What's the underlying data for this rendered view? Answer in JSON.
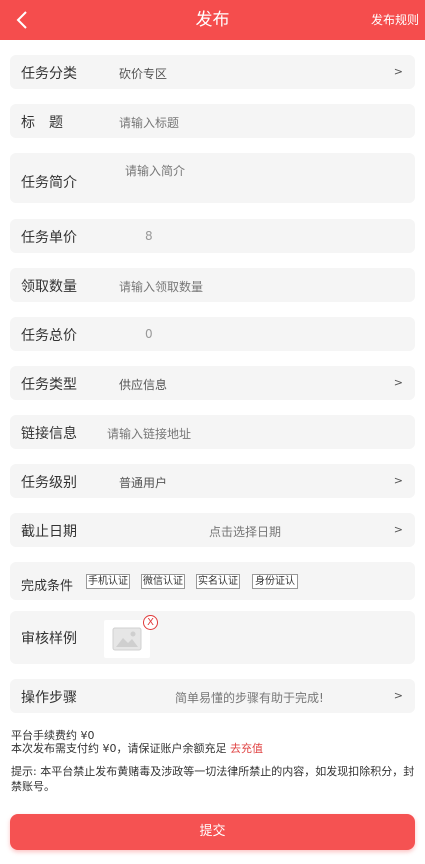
{
  "header": {
    "title": "发布",
    "rules_label": "发布规则"
  },
  "form": {
    "category": {
      "label": "任务分类",
      "value": "砍价专区",
      "arrow": ">"
    },
    "title": {
      "label": "标　题",
      "placeholder": "请输入标题"
    },
    "intro": {
      "label": "任务简介",
      "placeholder": "请输入简介"
    },
    "unit_price": {
      "label": "任务单价",
      "value": "8"
    },
    "quantity": {
      "label": "领取数量",
      "placeholder": "请输入领取数量"
    },
    "total_price": {
      "label": "任务总价",
      "value": "0"
    },
    "task_type": {
      "label": "任务类型",
      "value": "供应信息",
      "arrow": ">"
    },
    "link": {
      "label": "链接信息",
      "placeholder": "请输入链接地址"
    },
    "level": {
      "label": "任务级别",
      "value": "普通用户",
      "arrow": ">"
    },
    "deadline": {
      "label": "截止日期",
      "placeholder": "点击选择日期",
      "arrow": ">"
    },
    "conditions": {
      "label": "完成条件",
      "items": [
        "手机认证",
        "微信认证",
        "实名认证",
        "身份证认"
      ]
    },
    "sample": {
      "label": "审核样例",
      "close": "X"
    },
    "steps": {
      "label": "操作步骤",
      "placeholder": "简单易懂的步骤有助于完成!",
      "arrow": ">"
    }
  },
  "fees": {
    "platform_fee": "平台手续费约 ¥0",
    "pay_text": "本次发布需支付约 ¥0，请保证账户余额充足",
    "recharge_link": "去充值"
  },
  "notice": "提示: 本平台禁止发布黄赌毒及涉政等一切法律所禁止的内容，如发现扣除积分，封禁账号。",
  "submit_label": "提交",
  "colors": {
    "brand": "#f54d4d",
    "row_bg": "#f5f5f5",
    "link": "#e04545"
  }
}
